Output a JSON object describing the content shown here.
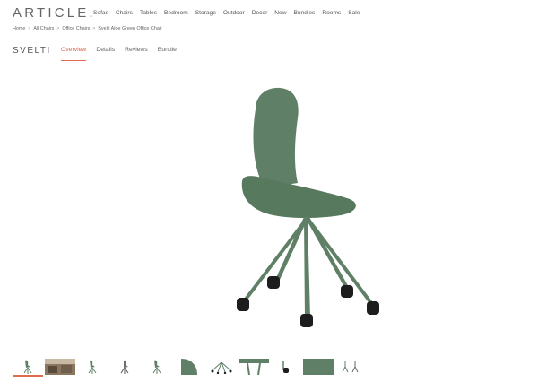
{
  "header": {
    "logo": "ARTICLE.",
    "nav": [
      "Sofas",
      "Chairs",
      "Tables",
      "Bedroom",
      "Storage",
      "Outdoor",
      "Decor",
      "New",
      "Bundles",
      "Rooms",
      "Sale"
    ]
  },
  "breadcrumb": [
    "Home",
    "All Chairs",
    "Office Chairs",
    "Svelti Aloe Green Office Chair"
  ],
  "product": {
    "brand": "SVELTI",
    "tabs": [
      "Overview",
      "Details",
      "Reviews",
      "Bundle"
    ],
    "active_tab": "Overview"
  },
  "colors": {
    "accent": "#e06b4f",
    "chair": "#5f8067",
    "wheel": "#1d1d1d"
  },
  "gallery": {
    "thumbnail_count": 11,
    "selected_index": 0
  }
}
